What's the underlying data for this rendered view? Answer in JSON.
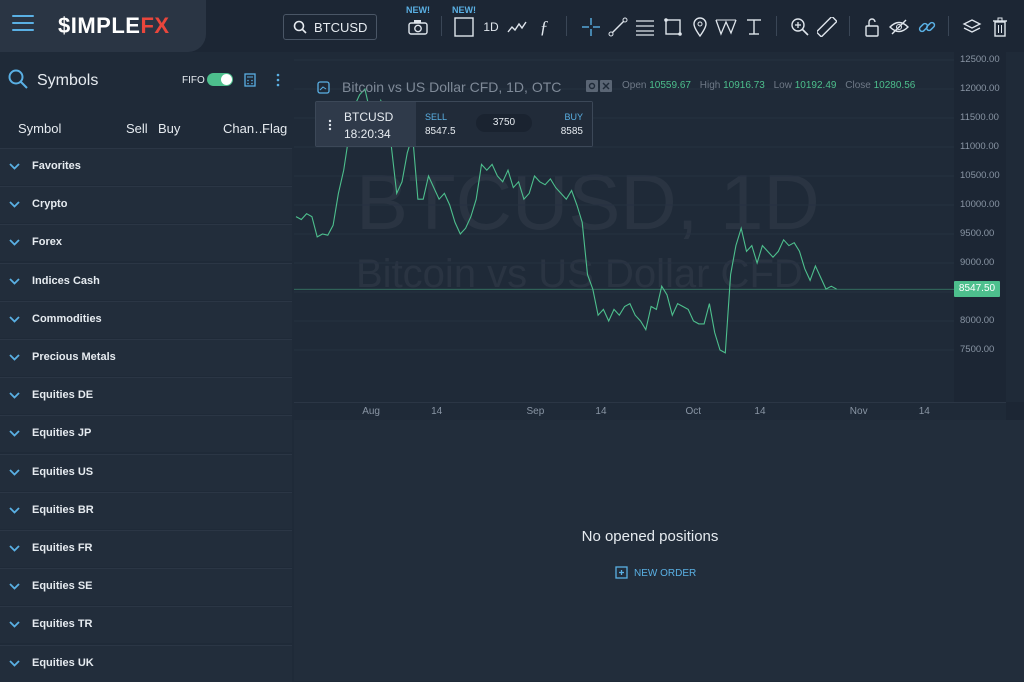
{
  "brand": {
    "logo_main": "$IMPLE",
    "logo_fx": "FX"
  },
  "toolbar": {
    "symbol": "BTCUSD",
    "new_label_1": "NEW!",
    "new_label_2": "NEW!",
    "interval": "1D",
    "icons": [
      "camera-icon",
      "square-icon",
      "line-chart-icon",
      "function-icon",
      "crosshair-icon",
      "trend-line-icon",
      "fib-icon",
      "rectangle-icon",
      "pin-icon",
      "pattern-icon",
      "measure-icon",
      "zoom-icon",
      "ruler-icon",
      "lock-icon",
      "eye-icon",
      "link-icon",
      "layers-icon",
      "trash-icon"
    ]
  },
  "sidebar": {
    "title": "Symbols",
    "fifo_label": "FIFO",
    "columns": {
      "symbol": "Symbol",
      "sell": "Sell",
      "buy": "Buy",
      "change": "Chan…",
      "flag": "Flag"
    },
    "categories": [
      "Favorites",
      "Crypto",
      "Forex",
      "Indices Cash",
      "Commodities",
      "Precious Metals",
      "Equities DE",
      "Equities JP",
      "Equities US",
      "Equities BR",
      "Equities FR",
      "Equities SE",
      "Equities TR",
      "Equities UK"
    ]
  },
  "chart": {
    "legend_title": "Bitcoin vs US Dollar CFD, 1D, OTC",
    "watermark_main": "BTCUSD, 1D",
    "watermark_sub": "Bitcoin vs US Dollar CFD",
    "ohlc": {
      "open_label": "Open",
      "open": "10559.67",
      "high_label": "High",
      "high": "10916.73",
      "low_label": "Low",
      "low": "10192.49",
      "close_label": "Close",
      "close": "10280.56"
    },
    "last_price": "8547.50"
  },
  "tradebox": {
    "symbol": "BTCUSD",
    "time": "18:20:34",
    "sell_label": "SELL",
    "sell": "8547.5",
    "spread": "3750",
    "buy_label": "BUY",
    "buy": "8585"
  },
  "chart_data": {
    "type": "line",
    "ylim": [
      7000,
      12500
    ],
    "yticks": [
      "12500.00",
      "12000.00",
      "11500.00",
      "11000.00",
      "10500.00",
      "10000.00",
      "9500.00",
      "9000.00",
      "8500.00",
      "8000.00",
      "7500.00"
    ],
    "xticks": [
      {
        "label": "Aug",
        "day": 14
      },
      {
        "label": "14",
        "day": 27
      },
      {
        "label": "Sep",
        "day": 45
      },
      {
        "label": "14",
        "day": 58
      },
      {
        "label": "Oct",
        "day": 75
      },
      {
        "label": "14",
        "day": 88
      },
      {
        "label": "Nov",
        "day": 106
      },
      {
        "label": "14",
        "day": 119
      }
    ],
    "values": [
      9800,
      9750,
      9850,
      9800,
      9450,
      9500,
      9480,
      9650,
      10200,
      10600,
      11200,
      11700,
      11900,
      12000,
      11600,
      11300,
      11800,
      11600,
      11000,
      10200,
      10400,
      10900,
      11200,
      10100,
      10100,
      10500,
      10300,
      10100,
      10200,
      10000,
      9700,
      9500,
      9600,
      9800,
      10100,
      10700,
      10600,
      10700,
      10500,
      10400,
      10600,
      10300,
      10400,
      10100,
      10200,
      10500,
      10400,
      10350,
      10450,
      10300,
      10200,
      10100,
      10250,
      10000,
      9700,
      8800,
      8550,
      8100,
      8200,
      8000,
      8200,
      8100,
      8250,
      8300,
      8100,
      8000,
      7850,
      8250,
      8200,
      8600,
      8450,
      8100,
      8300,
      8250,
      8200,
      8000,
      7950,
      7950,
      8300,
      7800,
      7500,
      7450,
      8800,
      9300,
      9600,
      9200,
      9300,
      9000,
      9300,
      9200,
      9100,
      9200,
      9400,
      9300,
      9350,
      9200,
      8900,
      8700,
      8950,
      8750,
      8550,
      8600,
      8550
    ]
  },
  "positions": {
    "empty_text": "No opened positions",
    "new_order": "NEW ORDER"
  }
}
